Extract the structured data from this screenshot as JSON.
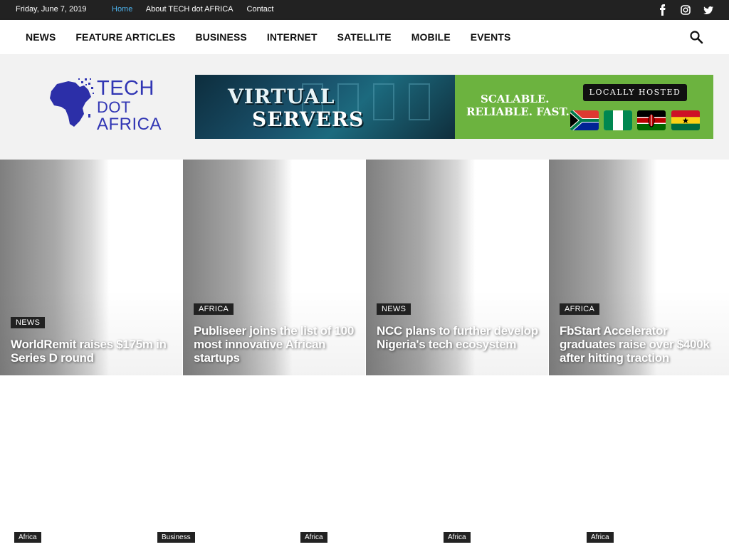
{
  "topbar": {
    "date": "Friday, June 7, 2019",
    "links": [
      "Home",
      "About TECH dot AFRICA",
      "Contact"
    ],
    "social": [
      "facebook-icon",
      "instagram-icon",
      "twitter-icon"
    ]
  },
  "nav": {
    "items": [
      "NEWS",
      "FEATURE ARTICLES",
      "BUSINESS",
      "INTERNET",
      "SATELLITE",
      "MOBILE",
      "EVENTS"
    ]
  },
  "logo": {
    "line1": "TECH",
    "line2": "DOT",
    "line3": "AFRICA"
  },
  "banner": {
    "headline1": "VIRTUAL",
    "headline2": "SERVERS",
    "tag1": "SCALABLE.",
    "tag2": "RELIABLE. FAST.",
    "pill": "LOCALLY HOSTED"
  },
  "featured": [
    {
      "category": "NEWS",
      "title": "WorldRemit raises $175m in Series D round"
    },
    {
      "category": "AFRICA",
      "title": "Publiseer joins the list of 100 most innovative African startups"
    },
    {
      "category": "NEWS",
      "title": "NCC plans to further develop Nigeria's tech ecosystem"
    },
    {
      "category": "AFRICA",
      "title": "FbStart Accelerator graduates raise over $400k after hitting traction"
    }
  ],
  "below_categories": [
    "Africa",
    "Business",
    "Africa",
    "Africa",
    "Africa"
  ],
  "colors": {
    "topbar_bg": "#222222",
    "active_link": "#4db2ec",
    "logo_blue": "#3136b4",
    "banner_green": "#6cb33f"
  }
}
